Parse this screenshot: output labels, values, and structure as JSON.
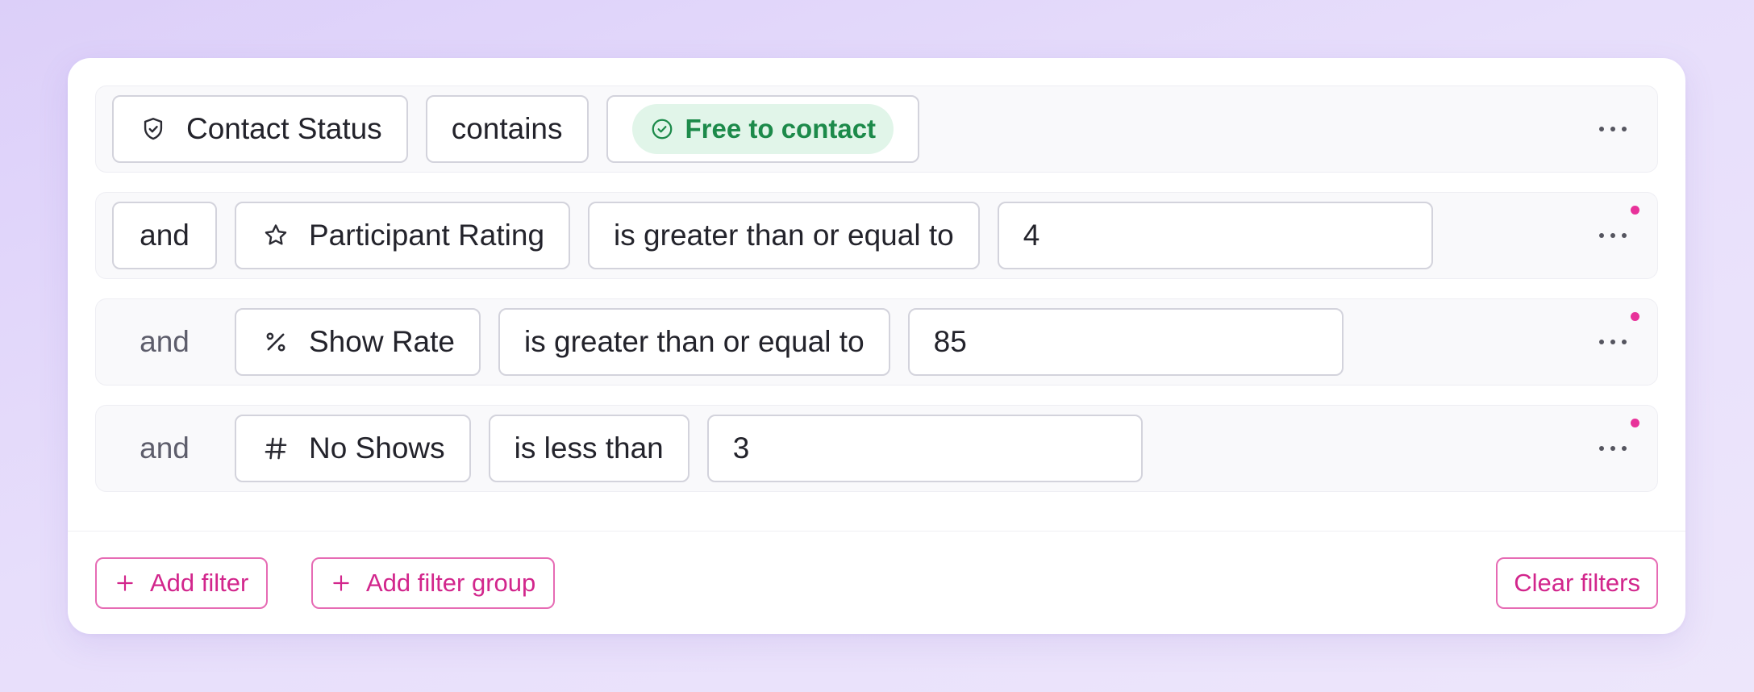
{
  "filters": [
    {
      "field": "Contact Status",
      "field_icon": "shield-check-icon",
      "operator": "contains",
      "value_chip": "Free to contact",
      "value_chip_icon": "check-circle-icon"
    },
    {
      "conjunction": "and",
      "field": "Participant Rating",
      "field_icon": "star-icon",
      "operator": "is greater than or equal to",
      "value": "4"
    },
    {
      "conjunction": "and",
      "field": "Show Rate",
      "field_icon": "percent-icon",
      "operator": "is greater than or equal to",
      "value": "85"
    },
    {
      "conjunction": "and",
      "field": "No Shows",
      "field_icon": "hash-icon",
      "operator": "is less than",
      "value": "3"
    }
  ],
  "footer": {
    "add_filter": "Add filter",
    "add_filter_group": "Add filter group",
    "clear_filters": "Clear filters"
  },
  "colors": {
    "accent": "#d2268c",
    "status_green": "#1c8a4a",
    "status_green_bg": "#e1f5e9",
    "unsaved_dot": "#e8329a"
  }
}
